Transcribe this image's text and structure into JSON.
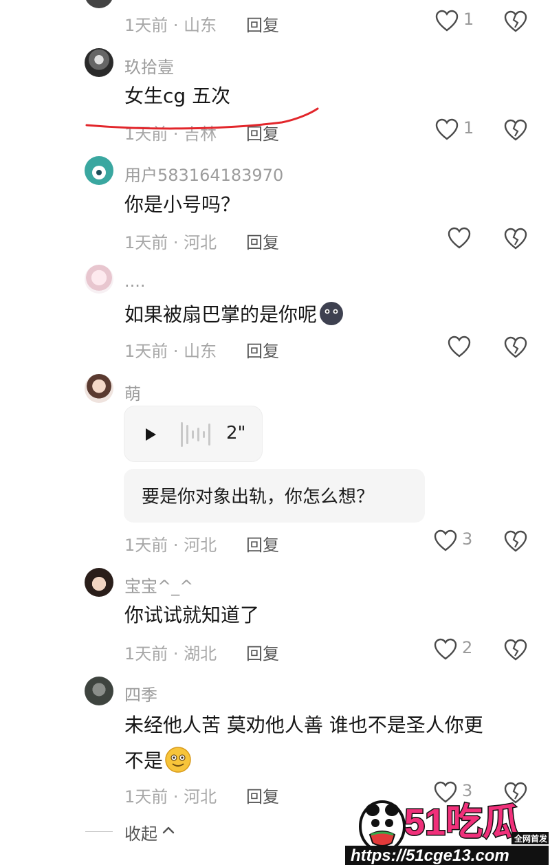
{
  "comments": [
    {
      "user": "",
      "text": "",
      "time": "1天前",
      "location": "山东",
      "reply_label": "回复",
      "likes": "1",
      "avatar": "avatar-0"
    },
    {
      "user": "玖拾壹",
      "text": "女生cg 五次",
      "time": "1天前",
      "location": "吉林",
      "reply_label": "回复",
      "likes": "1",
      "avatar": "avatar-1"
    },
    {
      "user": "用户583164183970",
      "text": "你是小号吗？",
      "time": "1天前",
      "location": "河北",
      "reply_label": "回复",
      "likes": "",
      "avatar": "avatar-2"
    },
    {
      "user": "....",
      "text": "如果被扇巴掌的是你呢",
      "time": "1天前",
      "location": "山东",
      "reply_label": "回复",
      "likes": "",
      "avatar": "avatar-3"
    },
    {
      "user": "萌",
      "voice_duration": "2\"",
      "quote": "要是你对象出轨，你怎么想？",
      "time": "1天前",
      "location": "河北",
      "reply_label": "回复",
      "likes": "3",
      "avatar": "avatar-4"
    },
    {
      "user": "宝宝^_^",
      "text": "你试试就知道了",
      "time": "1天前",
      "location": "湖北",
      "reply_label": "回复",
      "likes": "2",
      "avatar": "avatar-5"
    },
    {
      "user": "四季",
      "text_line1": "未经他人苦  莫劝他人善 谁也不是圣人你更",
      "text_line2": "不是",
      "time": "1天前",
      "location": "河北",
      "reply_label": "回复",
      "likes": "3",
      "avatar": "avatar-6"
    }
  ],
  "sep": " · ",
  "collapse_label": "收起",
  "watermark": {
    "brand": "51吃瓜",
    "tag": "全网首发",
    "url": "https://51cge13.com"
  },
  "colors": {
    "accent_red": "#e2262b",
    "watermark_pink": "#f0307a",
    "muted_text": "#a8a8a8"
  },
  "icons": [
    "heart-icon",
    "broken-heart-icon",
    "play-icon",
    "waveform-icon",
    "chevron-up-icon",
    "emoji-dark-face-icon",
    "emoji-smile-icon"
  ]
}
